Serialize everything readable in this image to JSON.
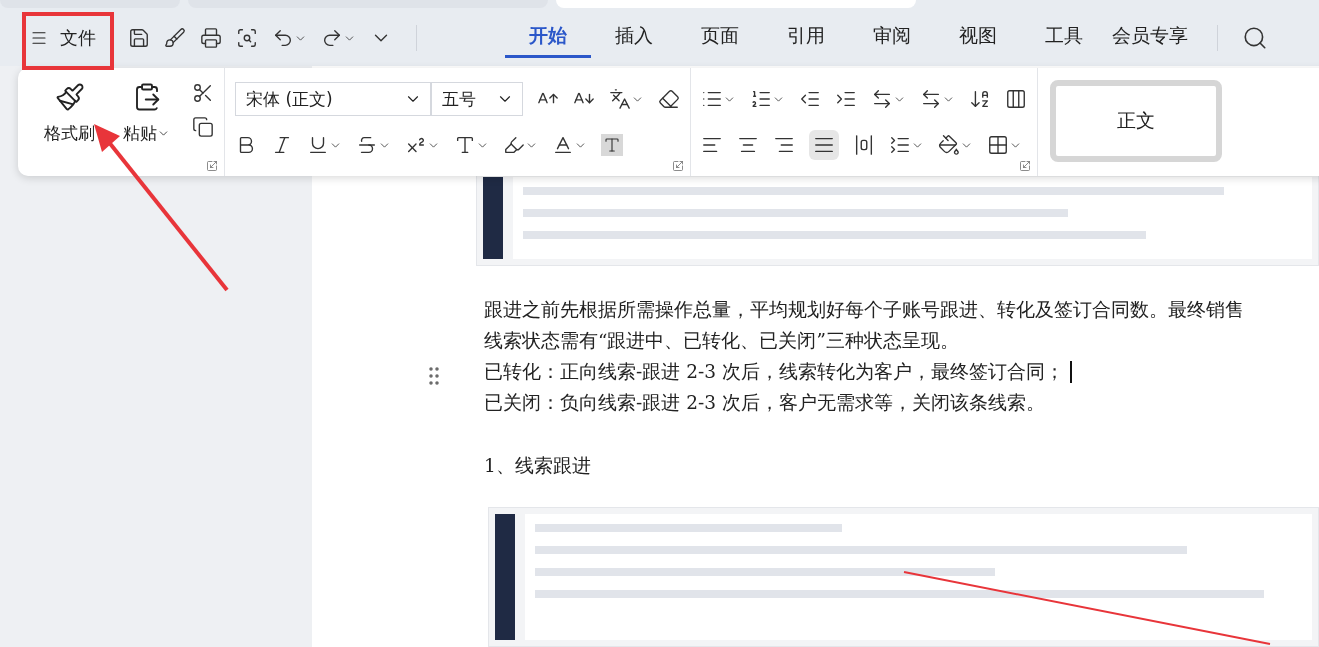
{
  "document_tabs": [
    {
      "selected": false
    },
    {
      "selected": false
    },
    {
      "selected": true
    }
  ],
  "toolbar": {
    "file_menu": "文件"
  },
  "tabs": [
    {
      "label": "开始",
      "selected": true
    },
    {
      "label": "插入",
      "selected": false
    },
    {
      "label": "页面",
      "selected": false
    },
    {
      "label": "引用",
      "selected": false
    },
    {
      "label": "审阅",
      "selected": false
    },
    {
      "label": "视图",
      "selected": false
    },
    {
      "label": "工具",
      "selected": false
    },
    {
      "label": "会员专享",
      "selected": false
    }
  ],
  "ribbon": {
    "format_painter": "格式刷",
    "paste": "粘贴",
    "font": "宋体 (正文)",
    "font_size": "五号",
    "style": "正文"
  },
  "document": {
    "lines": [
      "跟进之前先根据所需操作总量，平均规划好每个子账号跟进、转化及签订合同数。最终销售",
      "线索状态需有“跟进中、已转化、已关闭”三种状态呈现。",
      "已转化：正向线索-跟进 2-3 次后，线索转化为客户，最终签订合同；",
      "已关闭：负向线索-跟进 2-3 次后，客户无需求等，关闭该条线索。"
    ],
    "heading": "1、线索跟进"
  }
}
